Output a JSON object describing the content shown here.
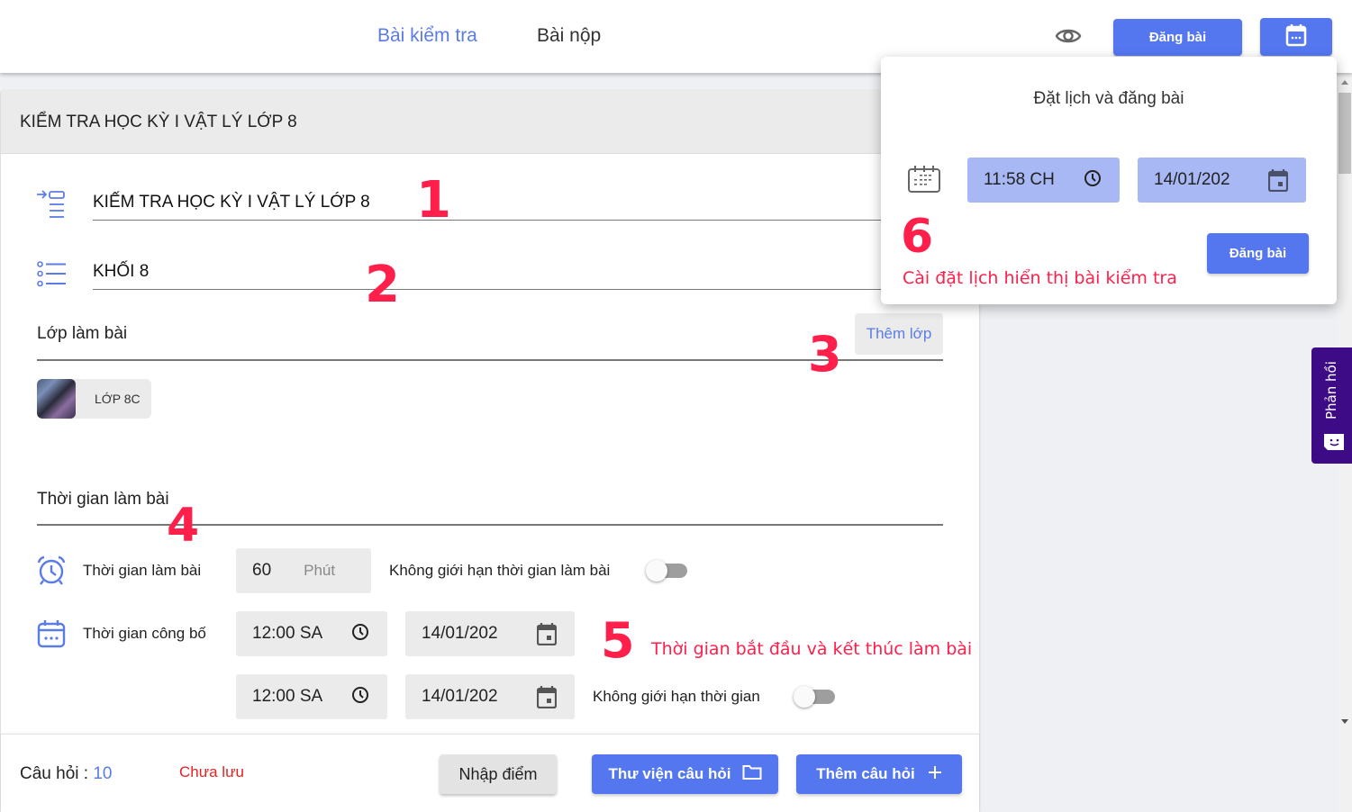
{
  "topbar": {
    "tabs": [
      {
        "label": "Bài kiểm tra",
        "active": true
      },
      {
        "label": "Bài nộp",
        "active": false
      }
    ],
    "preview_icon": "eye-icon",
    "post_button": "Đăng bài",
    "schedule_icon": "calendar-icon"
  },
  "main": {
    "header_title": "KIỂM TRA HỌC KỲ I VẬT LÝ LỚP 8",
    "title_field": {
      "value": "KIẾM TRA HỌC KỲ I VẬT LÝ LỚP 8",
      "icon": "title-list-icon"
    },
    "grade_field": {
      "value": "KHỐI 8",
      "icon": "bullet-list-icon"
    },
    "class_section": {
      "label": "Lớp làm bài",
      "add_button": "Thêm lớp",
      "classes": [
        {
          "name": "LỚP 8C"
        }
      ]
    },
    "time_section": {
      "label": "Thời gian làm bài",
      "duration": {
        "label": "Thời gian làm bài",
        "value": "60",
        "unit": "Phút",
        "icon": "alarm-clock-icon"
      },
      "unlimited_duration": {
        "label": "Không giới hạn thời gian làm bài",
        "enabled": false
      },
      "publish": {
        "label": "Thời gian công bố",
        "icon": "calendar-icon",
        "start": {
          "time": "12:00 SA",
          "date": "14/01/202"
        },
        "end": {
          "time": "12:00 SA",
          "date": "14/01/202"
        }
      },
      "unlimited_time": {
        "label": "Không giới hạn thời gian",
        "enabled": false
      }
    }
  },
  "annotations": [
    {
      "num": "1"
    },
    {
      "num": "2"
    },
    {
      "num": "3"
    },
    {
      "num": "4"
    },
    {
      "num": "5",
      "text": "Thời gian bắt đầu và kết thúc làm bài"
    },
    {
      "num": "6",
      "text": "Cài đặt lịch hiển thị bài kiểm tra"
    }
  ],
  "footer": {
    "questions_label": "Câu hỏi : ",
    "questions_count": "10",
    "status": "Chưa lưu",
    "enter_score": "Nhập điểm",
    "question_library": "Thư viện câu hỏi",
    "add_question": "Thêm câu hỏi"
  },
  "schedule_popover": {
    "title": "Đặt lịch và đăng bài",
    "time": "11:58 CH",
    "date": "14/01/202",
    "post_button": "Đăng bài"
  },
  "feedback": {
    "label": "Phản hồi"
  },
  "colors": {
    "accent": "#5477f0",
    "annotation": "#ff1f4b",
    "feedback": "#3d0b86",
    "unsaved": "#e52222"
  }
}
